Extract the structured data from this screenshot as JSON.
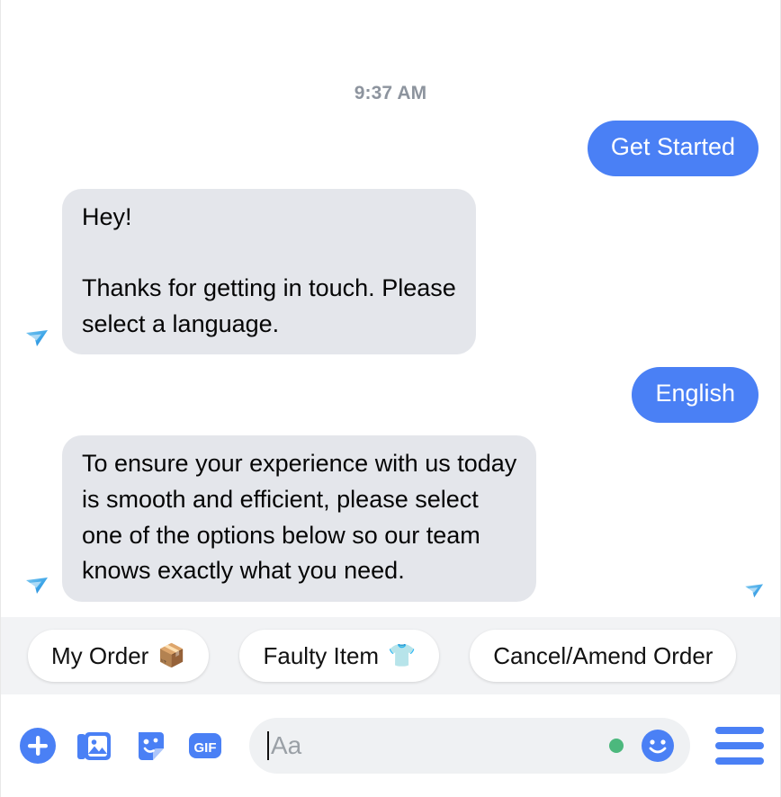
{
  "colors": {
    "outgoing_bubble": "#4a80f5",
    "incoming_bubble": "#e4e6eb",
    "accent_blue": "#4a80f5",
    "status_green": "#4cb87d",
    "quick_reply_bg": "#f2f3f5",
    "timestamp_text": "#8d949e"
  },
  "conversation": {
    "timestamp": "9:37 AM",
    "messages": [
      {
        "sender": "user",
        "text": "Get Started",
        "has_avatar": false
      },
      {
        "sender": "bot",
        "text": "Hey!\n\nThanks for getting in touch. Please\nselect a language.",
        "has_avatar": true,
        "avatar_icon": "brand-arrow-logo-icon"
      },
      {
        "sender": "user",
        "text": "English",
        "has_avatar": false
      },
      {
        "sender": "bot",
        "text": "To ensure your experience with us today\nis smooth and efficient, please select\none of the options below so our team\nknows exactly what you need.",
        "has_avatar": true,
        "avatar_icon": "brand-arrow-logo-icon"
      }
    ],
    "trailing_avatar_icon": "brand-arrow-logo-icon"
  },
  "quick_replies": [
    {
      "label": "My Order",
      "emoji": "📦",
      "emoji_name": "package-emoji"
    },
    {
      "label": "Faulty Item",
      "emoji": "👕",
      "emoji_name": "tshirt-emoji"
    },
    {
      "label": "Cancel/Amend Order",
      "emoji": "",
      "emoji_name": ""
    }
  ],
  "composer": {
    "tools": [
      {
        "name": "add-plus-icon",
        "label": "Add"
      },
      {
        "name": "photo-gallery-icon",
        "label": "Photos"
      },
      {
        "name": "sticker-icon",
        "label": "Stickers"
      },
      {
        "name": "gif-icon",
        "label": "GIF"
      }
    ],
    "gif_label": "GIF",
    "input": {
      "value": "",
      "placeholder": "Aa"
    },
    "emoji_button_label": "Emoji",
    "menu_button_label": "Menu"
  }
}
